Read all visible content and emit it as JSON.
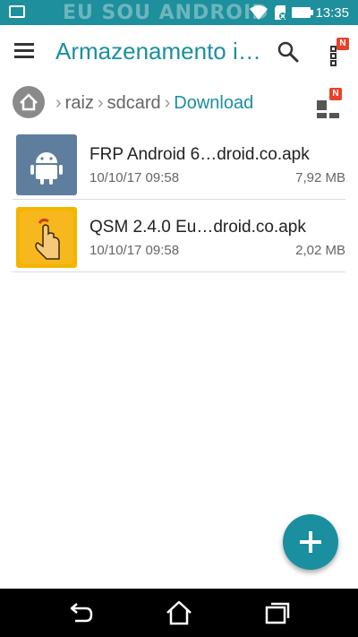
{
  "status_bar": {
    "time": "13:35",
    "watermark": "EU SOU ANDROID",
    "icons": [
      "gallery-icon",
      "wifi-icon",
      "sd-card-icon",
      "battery-icon"
    ]
  },
  "app_bar": {
    "title": "Armazenamento i…",
    "icons": [
      "menu-icon",
      "search-icon",
      "more-icon"
    ],
    "badge": "N"
  },
  "breadcrumb": {
    "items": [
      "raiz",
      "sdcard",
      "Download"
    ],
    "home_icon": "home-icon",
    "view_toggle_icon": "grid-view-icon",
    "badge": "N"
  },
  "files": [
    {
      "name": "FRP Android 6…droid.co.apk",
      "date": "10/10/17 09:58",
      "size": "7,92 MB",
      "icon": "android-apk-icon"
    },
    {
      "name": "QSM 2.4.0 Eu…droid.co.apk",
      "date": "10/10/17 09:58",
      "size": "2,02 MB",
      "icon": "touch-app-icon"
    }
  ],
  "fab": {
    "icon": "plus-icon"
  },
  "nav_bar": {
    "icons": [
      "back-icon",
      "home-icon",
      "recents-icon"
    ]
  },
  "colors": {
    "accent": "#1a8fa0",
    "status_bar": "#1e8f9c",
    "apk_thumb": "#5f7e9e",
    "qsm_thumb": "#f4b400"
  }
}
